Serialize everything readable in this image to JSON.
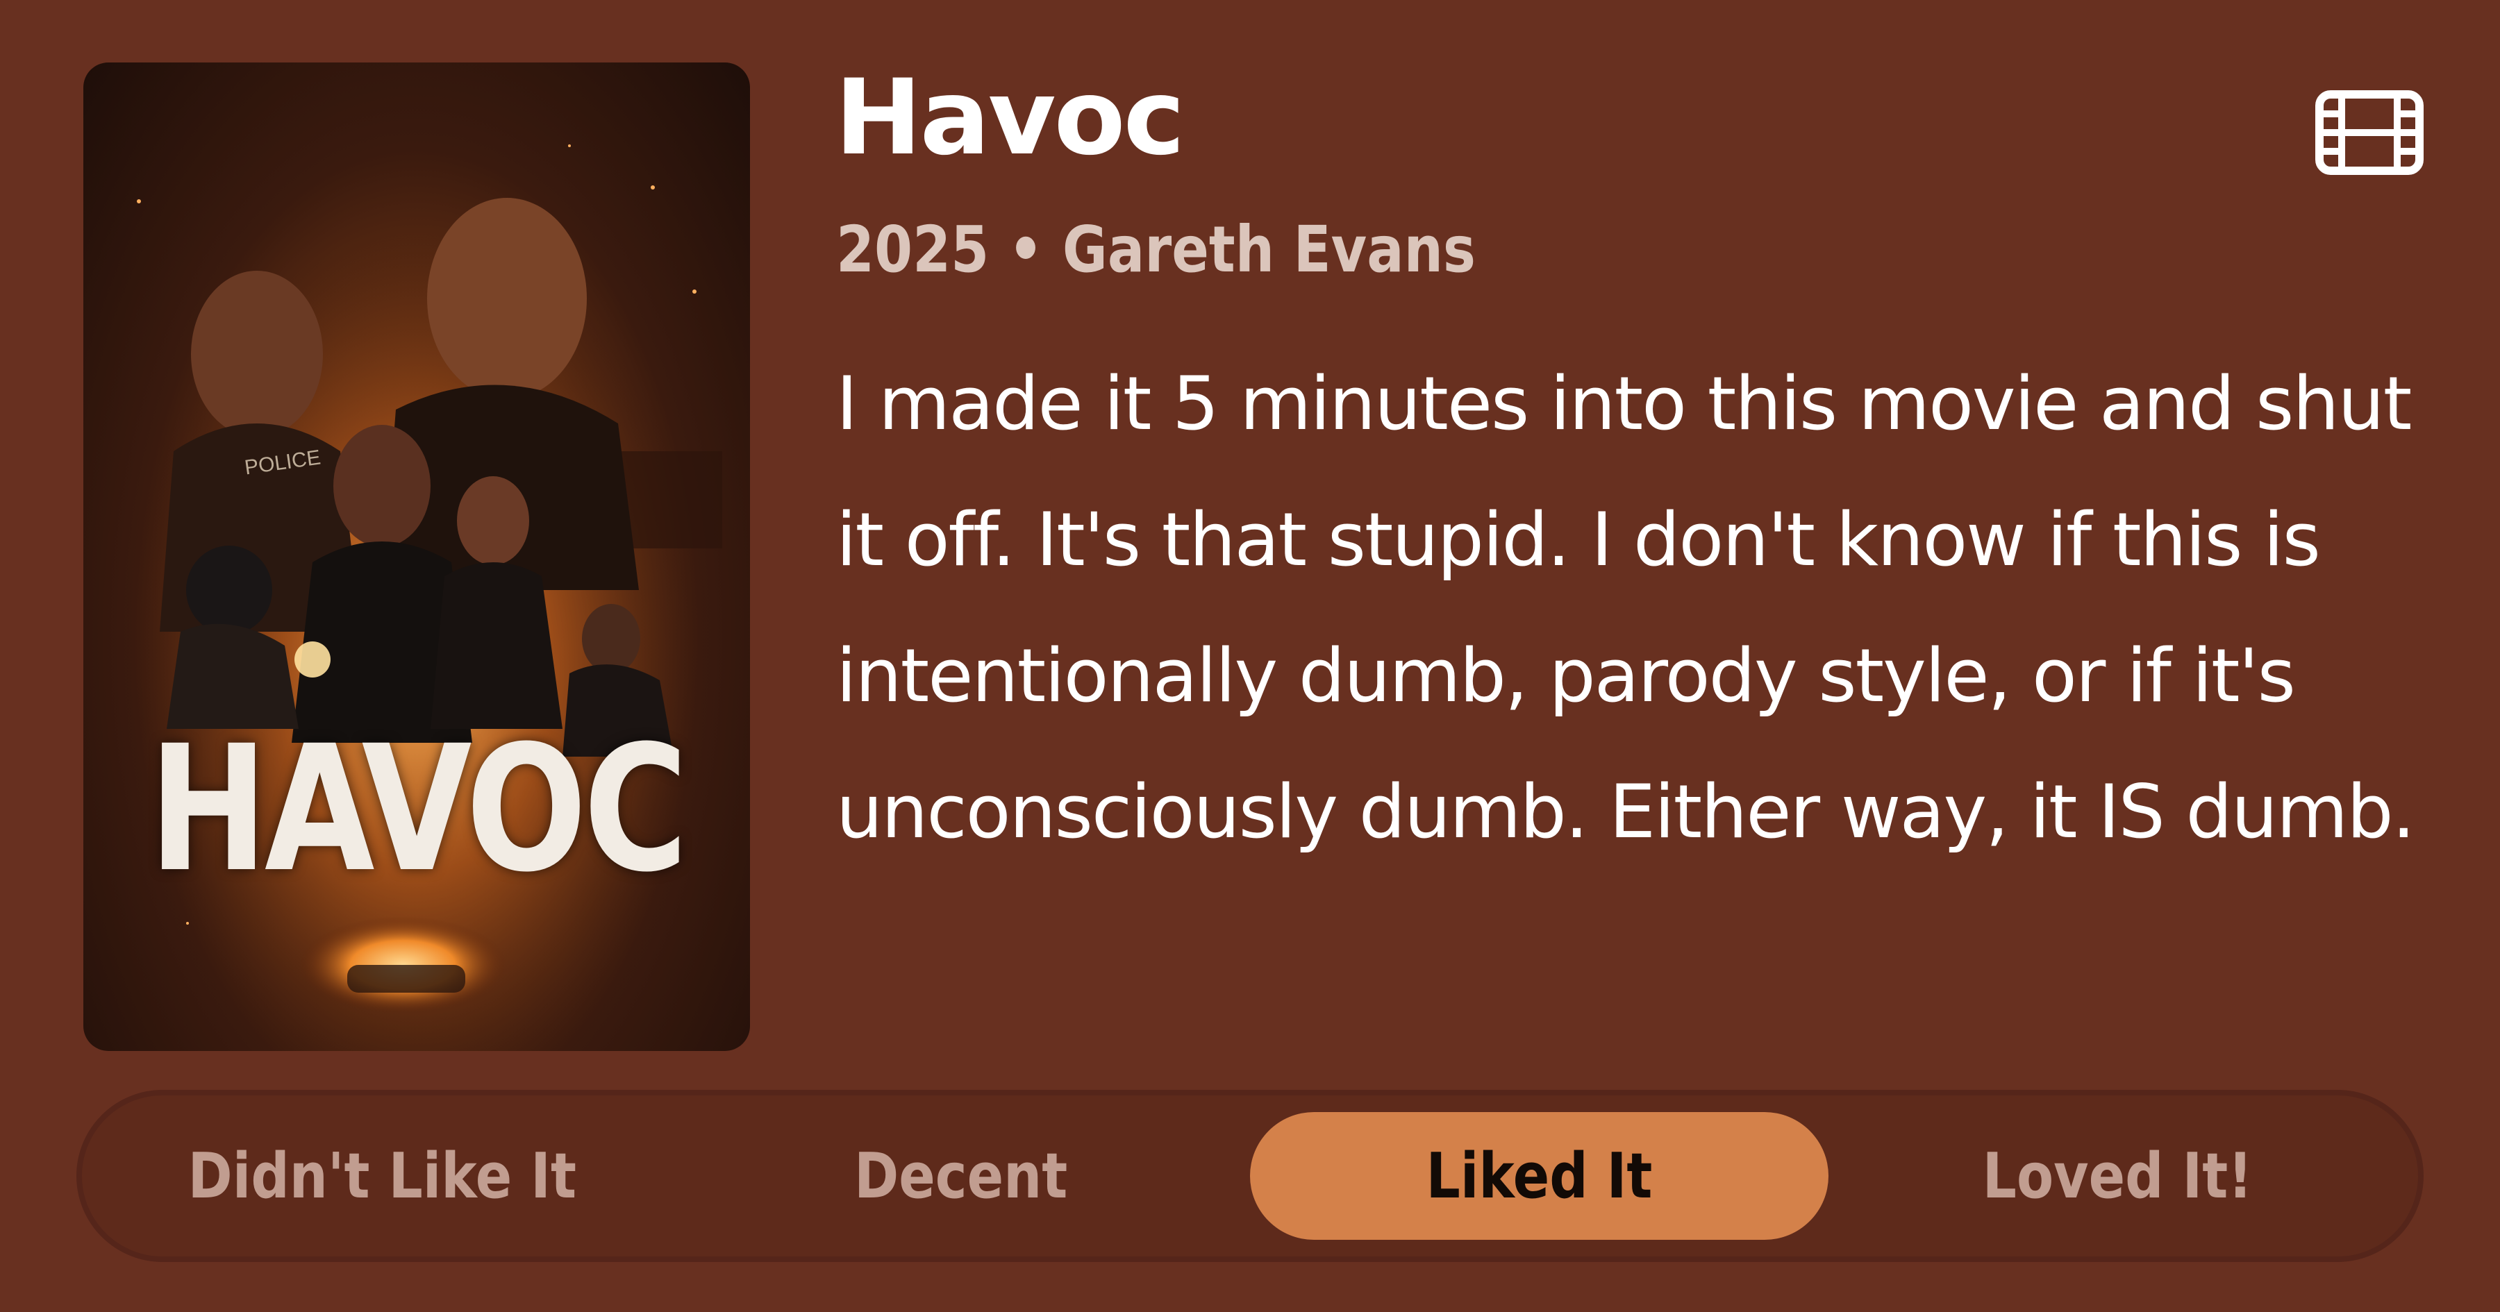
{
  "movie": {
    "title": "Havoc",
    "year": "2025",
    "separator": "•",
    "director": "Gareth Evans",
    "review": "I made it 5 minutes into this movie and shut it off. It's that stupid. I don't know if this is intentionally dumb, parody style, or if it's unconsciously dumb. Either way, it IS dumb.",
    "poster": {
      "title_text": "HAVOC",
      "police_text": "POLICE"
    }
  },
  "type_icon": "film-icon",
  "rating": {
    "options": [
      "Didn't Like It",
      "Decent",
      "Liked It",
      "Loved It!"
    ],
    "selected": "Liked It"
  },
  "colors": {
    "background": "#683020",
    "selected_pill": "#d4814a",
    "muted_text": "#c19d90",
    "subtitle_text": "#dbc5bb"
  }
}
